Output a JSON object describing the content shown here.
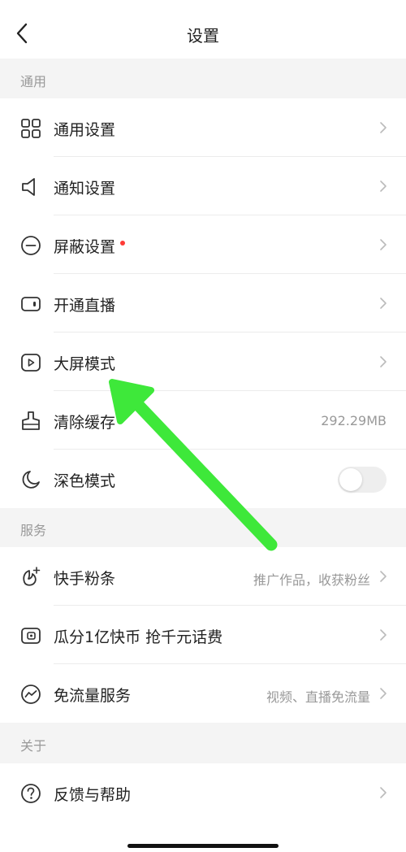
{
  "header": {
    "title": "设置"
  },
  "sections": {
    "general": "通用",
    "service": "服务",
    "about": "关于"
  },
  "general_items": [
    {
      "label": "通用设置"
    },
    {
      "label": "通知设置"
    },
    {
      "label": "屏蔽设置",
      "new_dot": true
    },
    {
      "label": "开通直播"
    },
    {
      "label": "大屏模式"
    },
    {
      "label": "清除缓存",
      "value": "292.29MB"
    },
    {
      "label": "深色模式",
      "toggle": false
    }
  ],
  "service_items": [
    {
      "label": "快手粉条",
      "value": "推广作品，收获粉丝"
    },
    {
      "label": "瓜分1亿快币 抢千元话费"
    },
    {
      "label": "免流量服务",
      "value": "视频、直播免流量"
    }
  ],
  "about_items": [
    {
      "label": "反馈与帮助"
    }
  ],
  "colors": {
    "accent_dot": "#fe3b36",
    "annotation_arrow": "#3ee83a",
    "section_bg": "#f4f4f4"
  }
}
